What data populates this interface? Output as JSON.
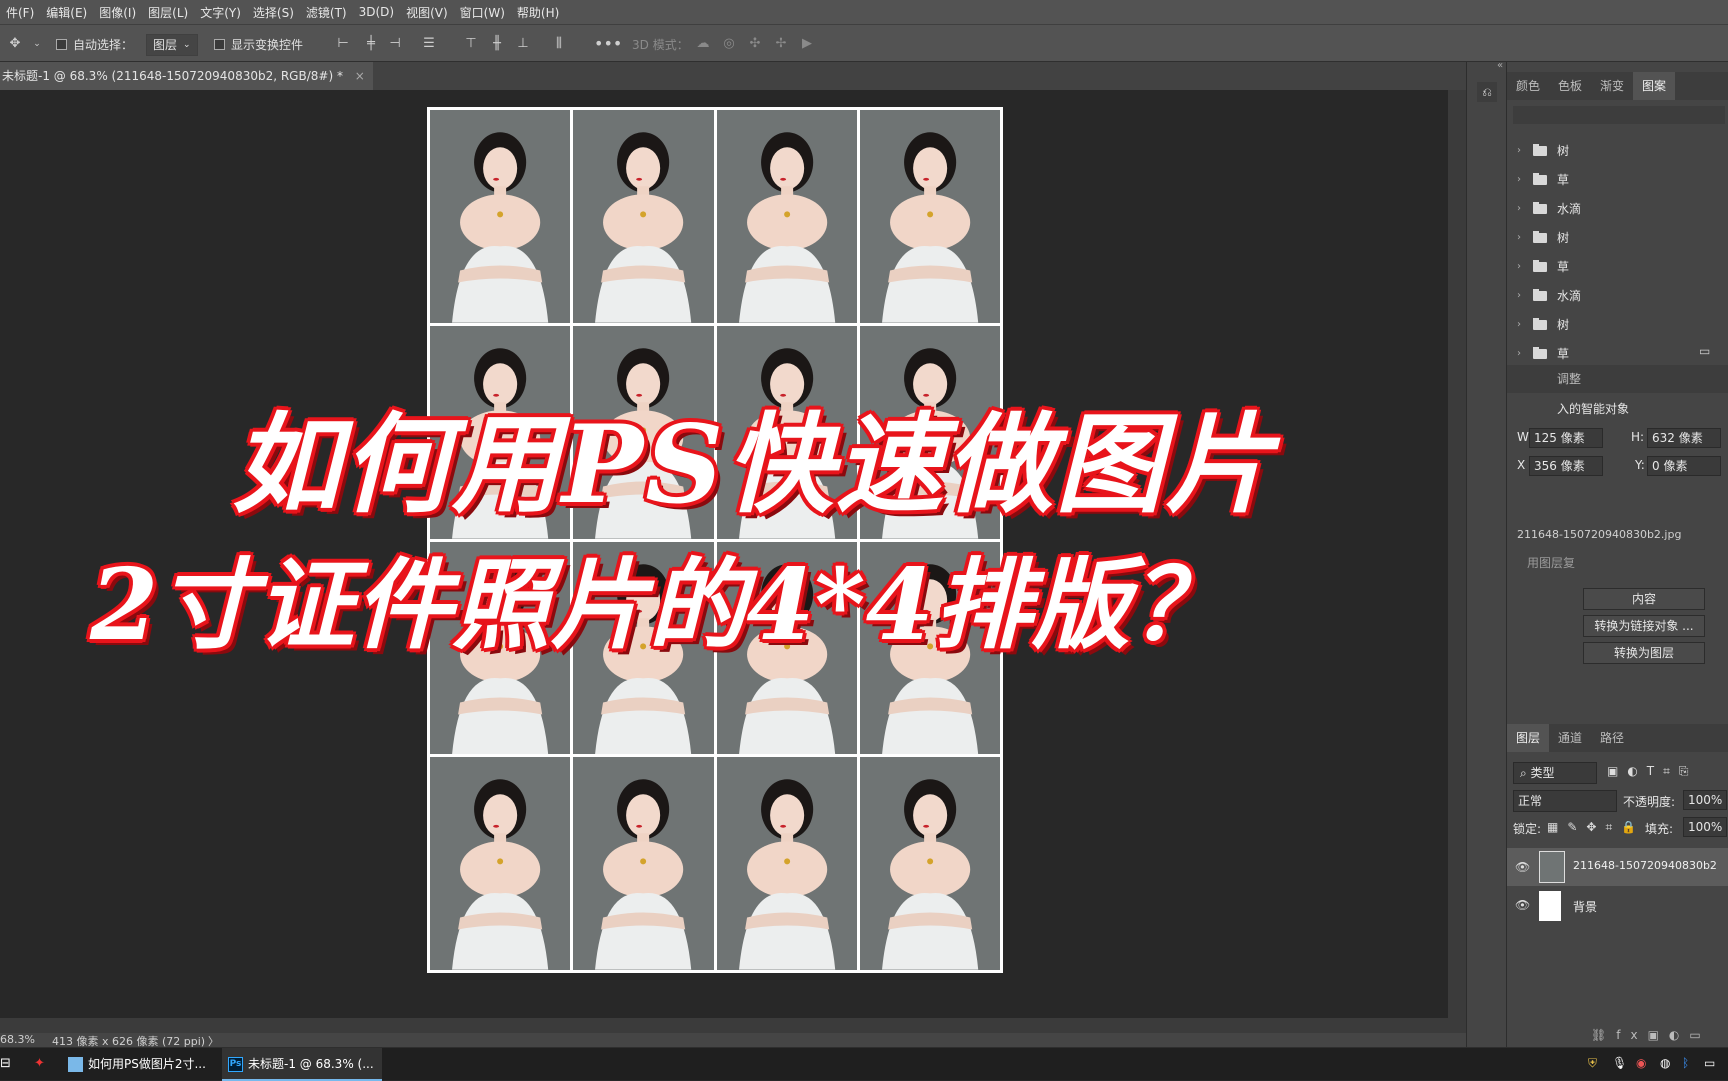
{
  "menubar": {
    "items": [
      "件(F)",
      "编辑(E)",
      "图像(I)",
      "图层(L)",
      "文字(Y)",
      "选择(S)",
      "滤镜(T)",
      "3D(D)",
      "视图(V)",
      "窗口(W)",
      "帮助(H)"
    ]
  },
  "options": {
    "auto_select_label": "自动选择：",
    "auto_select_value": "图层",
    "show_transform_label": "显示变换控件",
    "mode_3d_label": "3D 模式："
  },
  "document": {
    "tab_title": "未标题-1 @ 68.3% (211648-150720940830b2, RGB/8#) *",
    "close": "×"
  },
  "status": {
    "zoom": "68.3%",
    "doc_info": "413 像素 x 626 像素 (72 ppi)",
    "arrow": "〉"
  },
  "overlay": {
    "line1": "如何用PS快速做图片",
    "line2": "2寸证件照片的4*4排版？"
  },
  "top_panel": {
    "tabs": [
      "颜色",
      "色板",
      "渐变",
      "图案"
    ],
    "active_tab": "图案",
    "pattern_folders": [
      "树",
      "草",
      "水滴",
      "树",
      "草",
      "水滴",
      "树",
      "草"
    ]
  },
  "properties": {
    "tab_label": "调整",
    "title": "入的智能对象",
    "w_label": "W:",
    "w_value": "125 像素",
    "h_label": "H:",
    "h_value": "632 像素",
    "x_label": "X",
    "x_value": "356 像素",
    "y_label": "Y:",
    "y_value": "0 像素",
    "filename": "211648-150720940830b2.jpg",
    "linked_label": "用图层复",
    "btn_edit": "内容",
    "btn_convert_linked": "转换为链接对象 ...",
    "btn_convert_layers": "转换为图层"
  },
  "layers_panel": {
    "tabs": [
      "图层",
      "通道",
      "路径"
    ],
    "active_tab": "图层",
    "filter_label": "类型",
    "blend_mode": "正常",
    "opacity_label": "不透明度:",
    "opacity_value": "100%",
    "lock_label": "锁定:",
    "fill_label": "填充:",
    "fill_value": "100%",
    "layers": [
      {
        "name": "211648-150720940830b2",
        "visible": true,
        "selected": true
      },
      {
        "name": "背景",
        "visible": true,
        "selected": false
      }
    ],
    "footer_fx": "fx"
  },
  "taskbar": {
    "items": [
      {
        "label": "如何用PS做图片2寸...",
        "active": false
      },
      {
        "label": "未标题-1 @ 68.3% (...",
        "active": true
      }
    ],
    "ps_icon_text": "Ps"
  },
  "colors": {
    "overlay_outline": "#e8141b",
    "photo_bg": "#6f7474",
    "accent": "#76b9ed"
  }
}
